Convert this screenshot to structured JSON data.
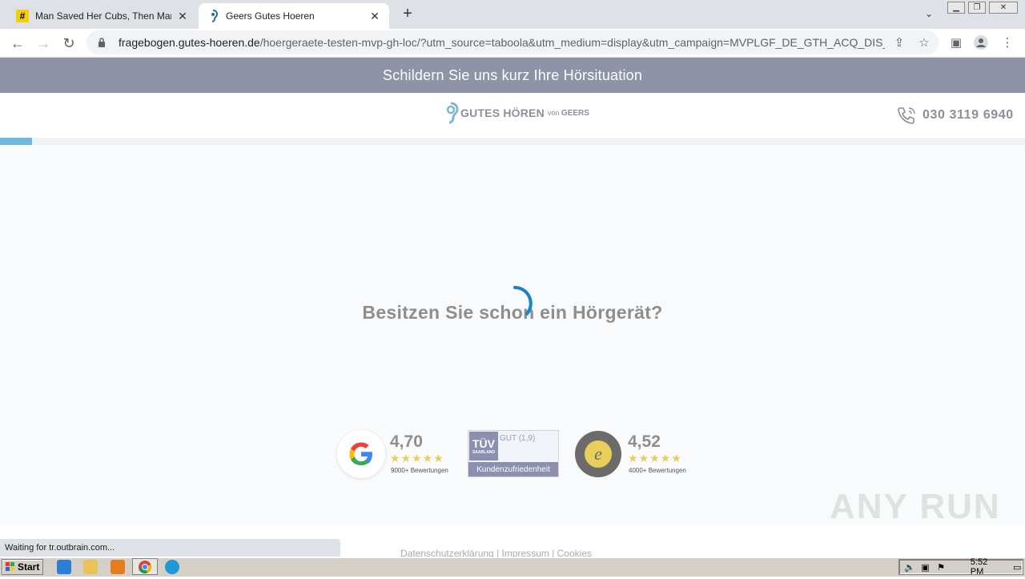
{
  "browser": {
    "tabs": [
      {
        "title": "Man Saved Her Cubs, Then Mama Be",
        "active": false,
        "favicon": "hash-icon"
      },
      {
        "title": "Geers Gutes Hoeren",
        "active": true,
        "favicon": "ear-icon"
      }
    ],
    "url_host": "fragebogen.gutes-hoeren.de",
    "url_path": "/hoergeraete-testen-mvp-gh-loc/?utm_source=taboola&utm_medium=display&utm_campaign=MVPLGF_DE_GTH_ACQ_DIS_...",
    "status_text": "Waiting for tr.outbrain.com..."
  },
  "page": {
    "banner": "Schildern Sie uns kurz Ihre Hörsituation",
    "logo_main": "GUTES HÖREN",
    "logo_von": "von",
    "logo_brand": "GEERS",
    "phone": "030 3119 6940",
    "progress": 0.031,
    "question": "Besitzen Sie schon ein Hörgerät?",
    "ratings": {
      "google": {
        "score": "4,70",
        "stars": "★★★★★",
        "count": "9000+ Bewertungen"
      },
      "tuv": {
        "logo": "TÜV",
        "logo_sub": "SAARLAND",
        "grade": "GUT (1,9)",
        "label": "Kundenzufriedenheit"
      },
      "trusted": {
        "score": "4,52",
        "stars": "★★★★★",
        "count": "4000+ Bewertungen"
      }
    },
    "footer_links": "Datenschutzerklärung | Impressum | Cookies"
  },
  "watermark": "ANY RUN",
  "taskbar": {
    "start_label": "Start",
    "clock": "5:52 PM"
  },
  "colors": {
    "banner": "#8e93a8",
    "progress": "#6fb8dc",
    "spinner": "#1a84c2"
  }
}
